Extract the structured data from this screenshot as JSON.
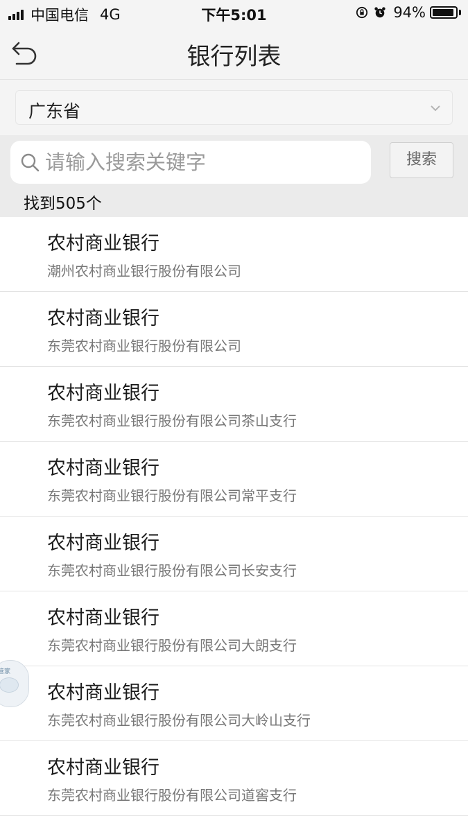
{
  "status_bar": {
    "carrier": "中国电信",
    "network": "4G",
    "time": "下午5:01",
    "battery_percent": "94%",
    "battery_level": 0.94,
    "icons": [
      "signal-icon",
      "rotation-lock-icon",
      "alarm-icon",
      "battery-icon"
    ]
  },
  "nav": {
    "title": "银行列表",
    "back_icon": "back-arrow-icon"
  },
  "province_select": {
    "value": "广东省",
    "icon": "chevron-down-icon"
  },
  "search": {
    "placeholder": "请输入搜索关键字",
    "value": "",
    "button_label": "搜索",
    "icon": "search-icon"
  },
  "results": {
    "count_text": "找到505个"
  },
  "banks": [
    {
      "name": "农村商业银行",
      "full_name": "潮州农村商业银行股份有限公司"
    },
    {
      "name": "农村商业银行",
      "full_name": "东莞农村商业银行股份有限公司"
    },
    {
      "name": "农村商业银行",
      "full_name": "东莞农村商业银行股份有限公司茶山支行"
    },
    {
      "name": "农村商业银行",
      "full_name": "东莞农村商业银行股份有限公司常平支行"
    },
    {
      "name": "农村商业银行",
      "full_name": "东莞农村商业银行股份有限公司长安支行"
    },
    {
      "name": "农村商业银行",
      "full_name": "东莞农村商业银行股份有限公司大朗支行"
    },
    {
      "name": "农村商业银行",
      "full_name": "东莞农村商业银行股份有限公司大岭山支行"
    },
    {
      "name": "农村商业银行",
      "full_name": "东莞农村商业银行股份有限公司道窖支行"
    }
  ],
  "floating_widget": {
    "label": "管家"
  },
  "colors": {
    "header_bg": "#f4f4f4",
    "search_row_bg": "#ebebeb",
    "divider": "#e3e3e3",
    "secondary_text": "#777777"
  }
}
